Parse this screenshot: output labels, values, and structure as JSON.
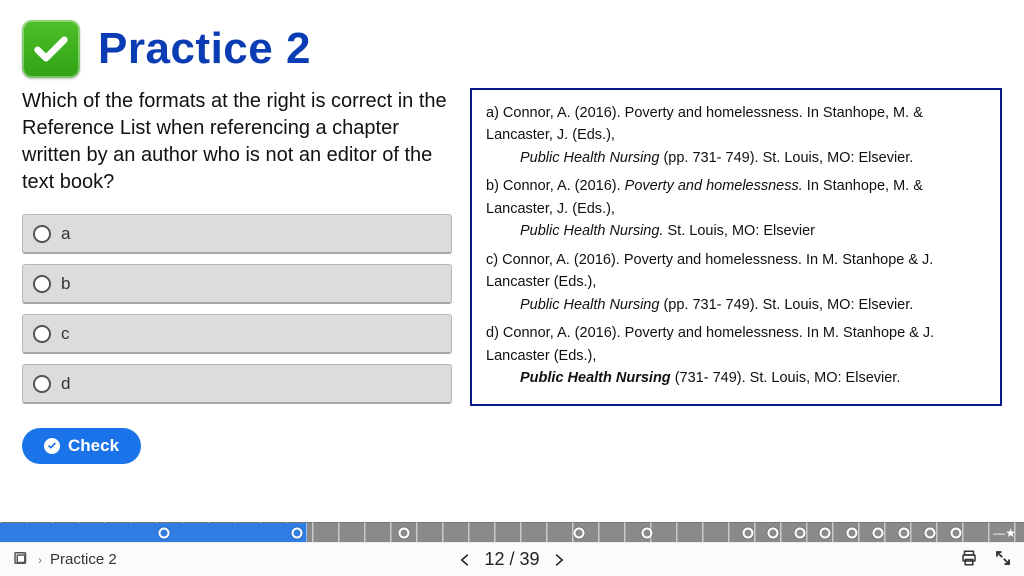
{
  "header": {
    "title": "Practice 2"
  },
  "question": "Which of the formats at the right is correct in the Reference List when referencing a chapter written by an author who is not an editor of the text book?",
  "options": [
    {
      "label": "a"
    },
    {
      "label": "b"
    },
    {
      "label": "c"
    },
    {
      "label": "d"
    }
  ],
  "check_label": "Check",
  "references": {
    "a": {
      "letter": "a)",
      "lead": " Connor, A. (2016). Poverty and homelessness. In Stanhope, M. & Lancaster, J. (Eds.),",
      "indent_italic": "Public Health Nursing",
      "indent_tail": " (pp. 731- 749). St. Louis, MO: Elsevier."
    },
    "b": {
      "letter": "b)",
      "lead_pre": " Connor, A. (2016). ",
      "lead_italic": "Poverty and homelessness.",
      "lead_post": " In Stanhope, M. & Lancaster, J. (Eds.),",
      "indent_italic": "Public Health Nursing.",
      "indent_tail": " St. Louis, MO: Elsevier"
    },
    "c": {
      "letter": "c)",
      "lead": " Connor, A. (2016). Poverty and homelessness. In M. Stanhope & J. Lancaster (Eds.),",
      "indent_italic": "Public Health Nursing",
      "indent_tail": " (pp. 731- 749). St. Louis, MO: Elsevier."
    },
    "d": {
      "letter": "d)",
      "lead": " Connor, A. (2016). Poverty and homelessness. In M. Stanhope & J. Lancaster (Eds.),",
      "indent_bold": "Public Health Nursing",
      "indent_tail": " (731- 749). St. Louis, MO: Elsevier."
    }
  },
  "progress": {
    "filled_percent": 30,
    "marker_positions_percent": [
      16,
      29,
      39.5,
      56.5,
      63.2,
      73,
      75.5,
      78.1,
      80.6,
      83.2,
      85.7,
      88.3,
      90.8,
      93.4
    ]
  },
  "footer": {
    "breadcrumb": "Practice 2",
    "page": "12",
    "sep": " / ",
    "total": "39"
  }
}
